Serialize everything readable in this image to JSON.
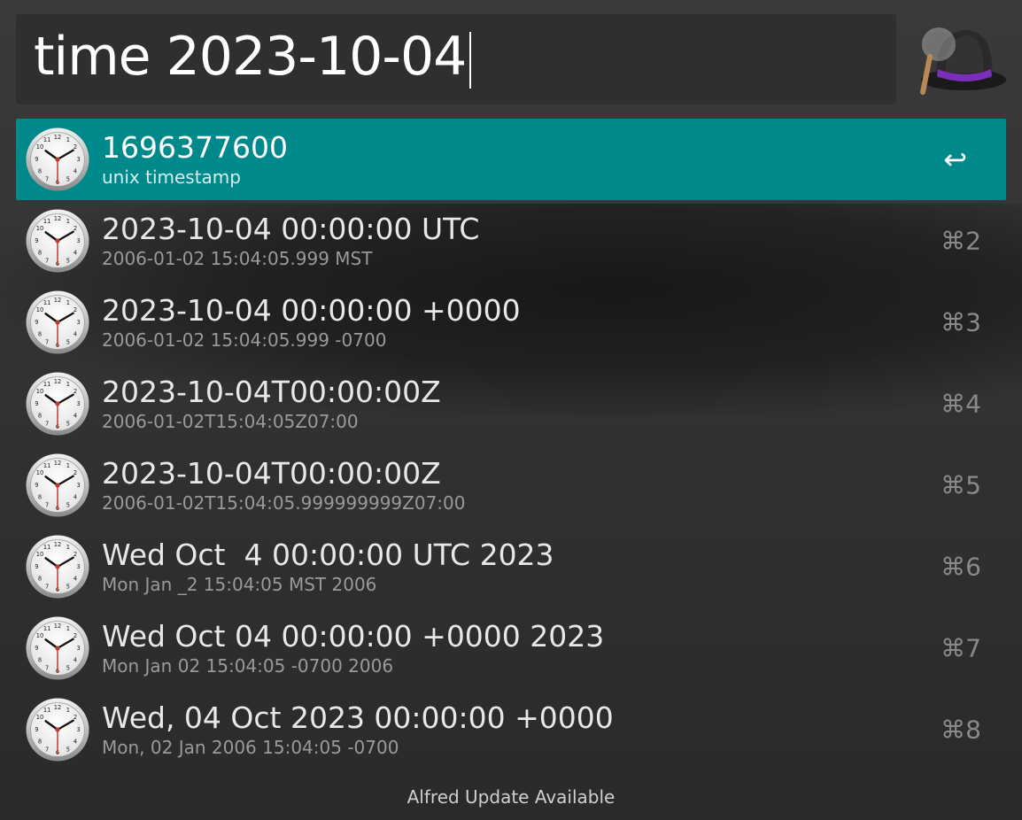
{
  "search": {
    "query": "time 2023-10-04"
  },
  "results": [
    {
      "title": "1696377600",
      "subtitle": "unix timestamp",
      "shortcut": "↩",
      "selected": true
    },
    {
      "title": "2023-10-04 00:00:00 UTC",
      "subtitle": "2006-01-02 15:04:05.999 MST",
      "shortcut": "⌘2"
    },
    {
      "title": "2023-10-04 00:00:00 +0000",
      "subtitle": "2006-01-02 15:04:05.999 -0700",
      "shortcut": "⌘3"
    },
    {
      "title": "2023-10-04T00:00:00Z",
      "subtitle": "2006-01-02T15:04:05Z07:00",
      "shortcut": "⌘4"
    },
    {
      "title": "2023-10-04T00:00:00Z",
      "subtitle": "2006-01-02T15:04:05.999999999Z07:00",
      "shortcut": "⌘5"
    },
    {
      "title": "Wed Oct  4 00:00:00 UTC 2023",
      "subtitle": "Mon Jan _2 15:04:05 MST 2006",
      "shortcut": "⌘6"
    },
    {
      "title": "Wed Oct 04 00:00:00 +0000 2023",
      "subtitle": "Mon Jan 02 15:04:05 -0700 2006",
      "shortcut": "⌘7"
    },
    {
      "title": "Wed, 04 Oct 2023 00:00:00 +0000",
      "subtitle": "Mon, 02 Jan 2006 15:04:05 -0700",
      "shortcut": "⌘8"
    }
  ],
  "footer": {
    "text": "Alfred Update Available"
  },
  "icons": {
    "result_icon": "clock-icon",
    "app_icon": "alfred-hat-icon"
  },
  "colors": {
    "selected_row": "#00898b",
    "background": "#333333"
  }
}
